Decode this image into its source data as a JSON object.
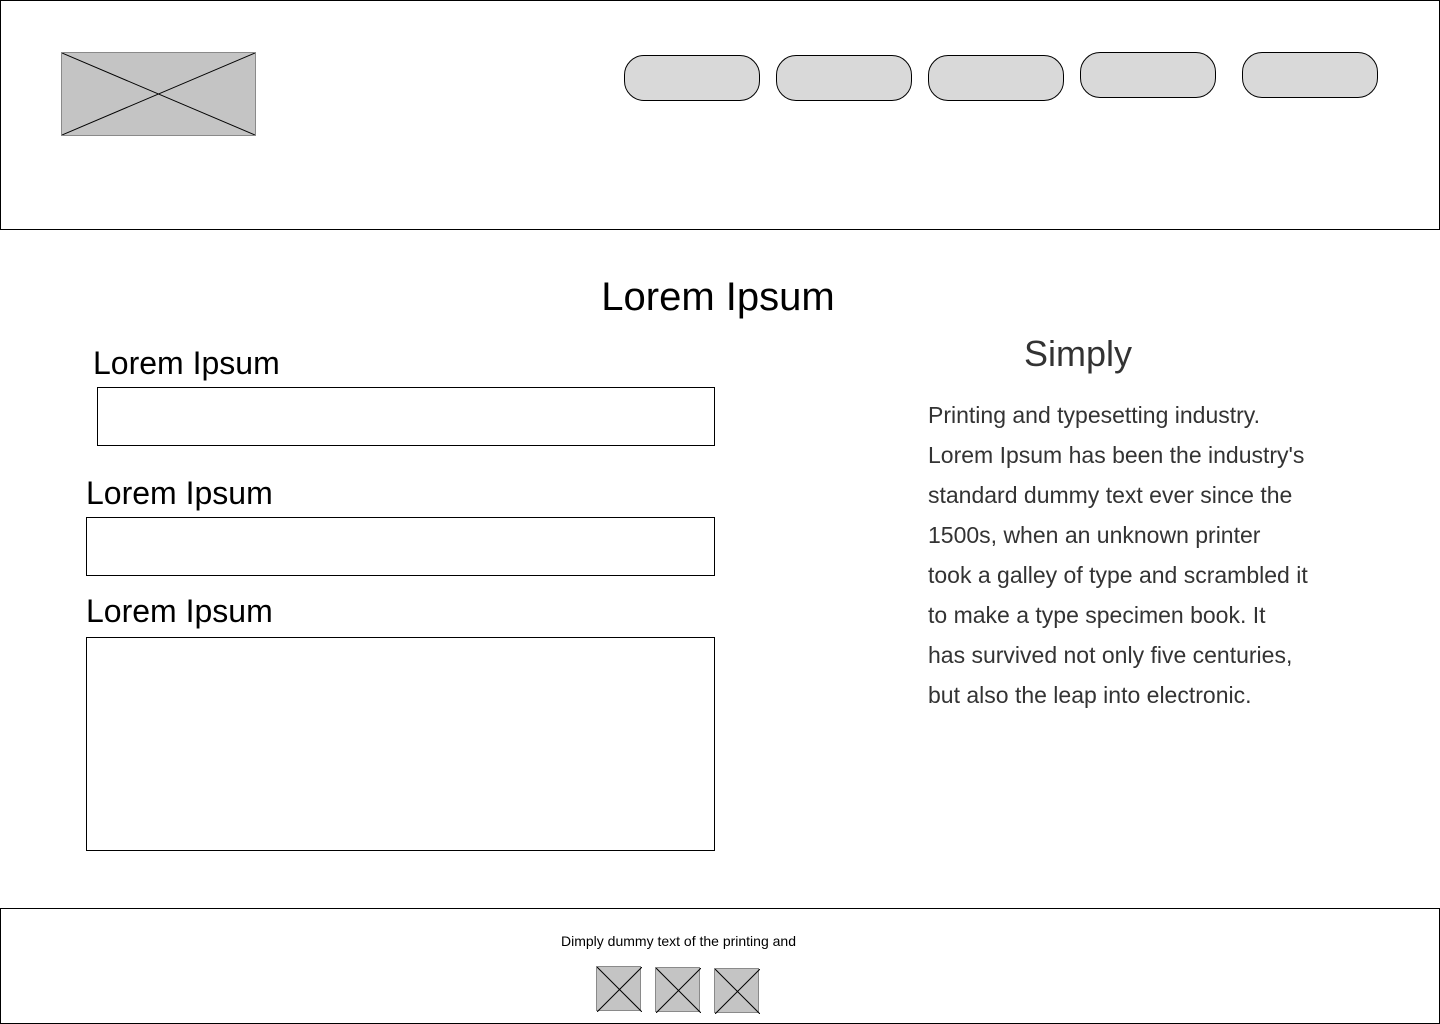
{
  "header": {
    "logo_icon": "image-placeholder-icon",
    "nav": [
      "",
      "",
      "",
      "",
      ""
    ]
  },
  "main": {
    "title": "Lorem Ipsum",
    "form": {
      "field1_label": "Lorem Ipsum",
      "field2_label": "Lorem Ipsum",
      "field3_label": "Lorem Ipsum"
    },
    "side": {
      "title": "Simply",
      "text": "Printing and typesetting industry. Lorem Ipsum has been the industry's standard dummy text ever since the 1500s, when an unknown printer took a galley of type and scrambled it to make a type specimen book. It has survived not only five centuries, but also the leap into electronic."
    }
  },
  "footer": {
    "text": "Dimply dummy text of the printing and",
    "icons": [
      "image-placeholder-icon",
      "image-placeholder-icon",
      "image-placeholder-icon"
    ]
  }
}
